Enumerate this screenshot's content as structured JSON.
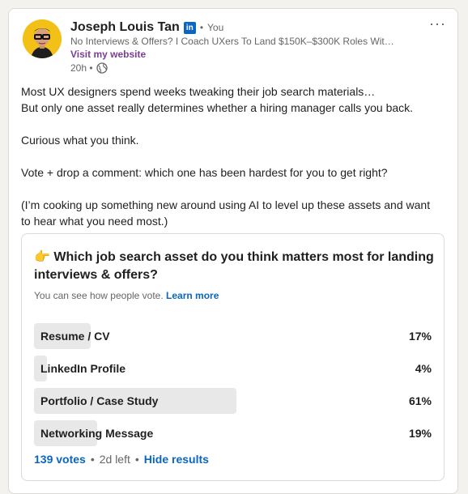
{
  "post": {
    "author_name": "Joseph Louis Tan",
    "linkedin_badge": "in",
    "separator": "•",
    "relationship": "You",
    "headline": "No Interviews & Offers? I Coach UXers To Land $150K–$300K Roles Wit…",
    "website_link": "Visit my website",
    "time": "20h •",
    "visibility_icon": "globe-icon",
    "menu_icon": "···",
    "body": [
      "Most UX designers spend weeks tweaking their job search materials…",
      "But only one asset really determines whether a hiring manager calls you back.",
      "Curious what you think.",
      "Vote + drop a comment: which one has been hardest for you to get right?",
      "(I’m cooking up something new around using AI to level up these assets and want to hear what you need most.)"
    ]
  },
  "poll": {
    "question": "👉 Which job search asset do you think matters most for landing interviews & offers?",
    "note": "You can see how people vote.",
    "learn_more": "Learn more",
    "options": [
      {
        "label": "Resume / CV",
        "percent_text": "17%",
        "fraction": 0.17
      },
      {
        "label": "LinkedIn Profile",
        "percent_text": "4%",
        "fraction": 0.04
      },
      {
        "label": "Portfolio / Case Study",
        "percent_text": "61%",
        "fraction": 0.61
      },
      {
        "label": "Networking Message",
        "percent_text": "19%",
        "fraction": 0.19
      }
    ],
    "votes": "139 votes",
    "sep": "•",
    "time_left": "2d left",
    "hide_results": "Hide results"
  },
  "colors": {
    "link_blue": "#0a66c2",
    "website_purple": "#7a3e96",
    "bar_fill": "#e8e8e8",
    "avatar_bg": "#f3c017"
  }
}
